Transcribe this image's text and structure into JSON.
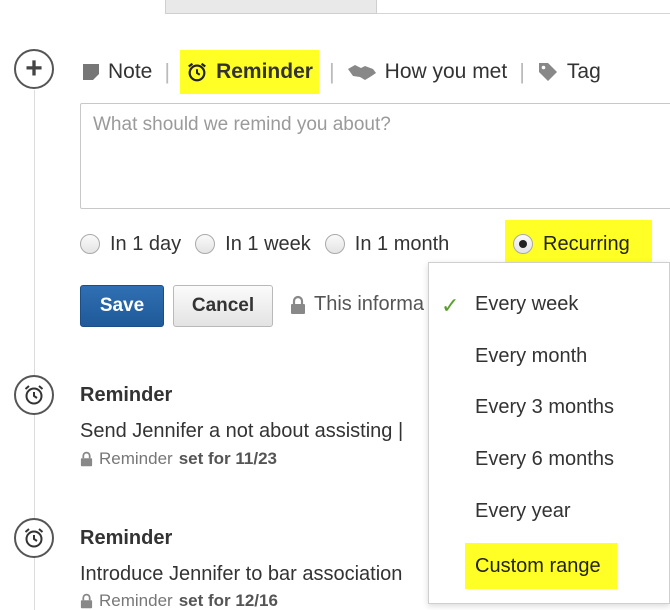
{
  "toolbar": {
    "note_label": "Note",
    "reminder_label": "Reminder",
    "how_you_met_label": "How you met",
    "tag_label": "Tag",
    "separator": "|"
  },
  "composer": {
    "placeholder": "What should we remind you about?"
  },
  "reminder_options": {
    "in_1_day": "In 1 day",
    "in_1_week": "In 1 week",
    "in_1_month": "In 1 month",
    "recurring": "Recurring",
    "selected": "Recurring"
  },
  "actions": {
    "save_label": "Save",
    "cancel_label": "Cancel",
    "privacy_text": "This informa"
  },
  "recurring_menu": {
    "selected": "Every week",
    "items": [
      "Every week",
      "Every month",
      "Every 3 months",
      "Every 6 months",
      "Every year",
      "Custom range"
    ]
  },
  "entries": [
    {
      "title": "Reminder",
      "description": "Send Jennifer a not about assisting |",
      "meta_prefix": "Reminder",
      "meta_value": "set for 11/23"
    },
    {
      "title": "Reminder",
      "description": "Introduce Jennifer to bar association",
      "meta_prefix": "Reminder",
      "meta_value": "set for 12/16"
    }
  ],
  "colors": {
    "highlight": "#ffff26",
    "save_button": "#2668ab",
    "check": "#5aa02c"
  }
}
